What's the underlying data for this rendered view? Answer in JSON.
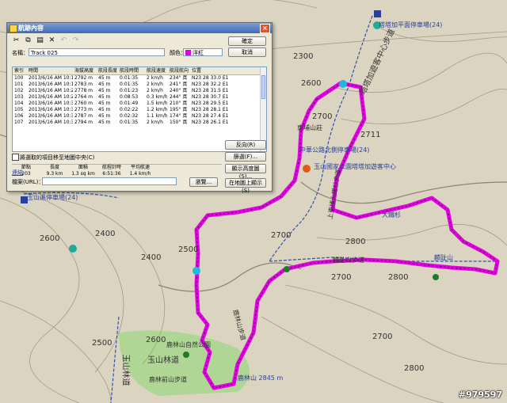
{
  "dialog": {
    "title": "航跡內容",
    "ok_label": "確定",
    "cancel_label": "取消",
    "name_label": "名稱：",
    "name_value": "Track 025",
    "color_label": "顏色：",
    "color_value": "洋紅",
    "color_hex": "#e000e0",
    "columns": [
      "索引",
      "時間",
      "海拔高度",
      "航段長度",
      "航段時間",
      "航段速度",
      "航段航向",
      "位置"
    ],
    "rows": [
      [
        "100",
        "2013/6/16 AM 10:17...",
        "2792 m",
        "45 m",
        "0:01:35",
        "2 km/h",
        "234° 真",
        "N23 28 33.0 E12"
      ],
      [
        "101",
        "2013/6/16 AM 10:19...",
        "2783 m",
        "45 m",
        "0:01:35",
        "2 km/h",
        "241° 真",
        "N23 28 32.2 E12"
      ],
      [
        "102",
        "2013/6/16 AM 10:20...",
        "2778 m",
        "45 m",
        "0:01:23",
        "2 km/h",
        "240° 真",
        "N23 28 31.5 E12"
      ],
      [
        "103",
        "2013/6/16 AM 10:21...",
        "2764 m",
        "45 m",
        "0:08:53",
        "0.3 km/h",
        "244° 真",
        "N23 28 30.7 E12"
      ],
      [
        "104",
        "2013/6/16 AM 10:30...",
        "2760 m",
        "45 m",
        "0:01:49",
        "1.5 km/h",
        "210° 真",
        "N23 28 29.5 E12"
      ],
      [
        "105",
        "2013/6/16 AM 10:32...",
        "2773 m",
        "45 m",
        "0:02:22",
        "1.2 km/h",
        "195° 真",
        "N23 28 28.1 E12"
      ],
      [
        "106",
        "2013/6/16 AM 10:35...",
        "2787 m",
        "45 m",
        "0:02:32",
        "1.1 km/h",
        "174° 真",
        "N23 28 27.4 E12"
      ],
      [
        "107",
        "2013/6/16 AM 10:37...",
        "2794 m",
        "45 m",
        "0:01:35",
        "2 km/h",
        "150° 真",
        "N23 28 26.1 E12"
      ]
    ],
    "checkbox_label": "將選取的項目移至地圖中央(C)",
    "stats_headers": [
      "節點",
      "長度",
      "面積",
      "航程計時",
      "平均航速"
    ],
    "stats_values": [
      "203",
      "9.3 km",
      "1.3 sq km",
      "6:51:36",
      "1.4 km/h"
    ],
    "link_label": "連結",
    "file_label": "檔案(URL)：",
    "browse_label": "瀏覽...",
    "reverse_label": "反向(R)",
    "filter_label": "篩選(F)...",
    "show_chart_label": "顯示高度圖(S)...",
    "show_on_map_label": "在地圖上顯示(S)"
  },
  "map": {
    "route_color": "#e400e4",
    "contours": [
      "2300",
      "2500",
      "2600",
      "2700",
      "2400",
      "2600",
      "2400",
      "2500",
      "2700",
      "2800",
      "2700",
      "2800",
      "2600",
      "2700",
      "2800",
      "2500",
      "2600",
      "2700",
      "2800",
      "2600",
      "2700"
    ],
    "labels": {
      "top_right_poi": "塔塔加平面停車場(24)",
      "trail_main": "塔塔加遊客中心步道",
      "lodge": "東埔山莊",
      "bus_stop": "中華公路北側停車場(24)",
      "visitor_center": "玉山國家公園塔塔加遊客中心",
      "road_label": "上東埔大鐵杉步道",
      "big_tree": "大鐵杉",
      "peak_label": "麟趾山",
      "peak_area": "麟趾山步道",
      "left_parking": "玉山進停車場(24)",
      "lulin_trail": "鹿林山步道",
      "lulin_park": "鹿林山自然公園",
      "yushan_forest": "玉山林道",
      "lulin_frontmtn": "鹿林前山步道",
      "lulin_peak": "鹿林山 2845 m",
      "yushan_forest_road": "玉山林道",
      "trail_road_left": "石水山步道",
      "area_west": "2711"
    },
    "watermark": "#979597"
  }
}
